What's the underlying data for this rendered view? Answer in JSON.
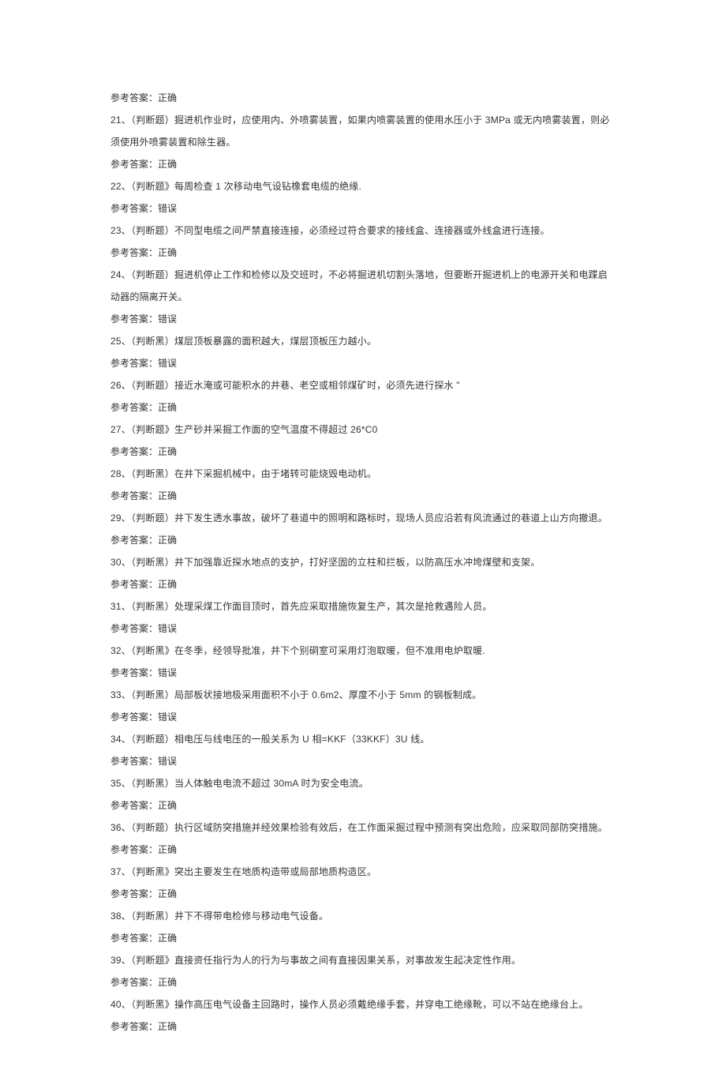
{
  "items": [
    {
      "n": "",
      "prefix": "",
      "text": "参考答案：正确",
      "type": "answer-only"
    },
    {
      "n": "21",
      "text": "、（判断题）掘进机作业时，应使用内、外喷雾装置，如果内喷雾装置的使用水压小于 3MPa 或无内喷雾装置，则必须使用外喷雾装置和除生器。",
      "answer": "参考答案：正确"
    },
    {
      "n": "22",
      "text": "、（判断题》每周检查 1 次移动电气设钻橡套电缆的绝缘.",
      "answer": "参考答案：错误"
    },
    {
      "n": "23",
      "text": "、（判断题）不同型电缆之间严禁直接连接，必须经过符合要求的接线盒、连接器或外线盒进行连接。",
      "answer": "参考答案：正确"
    },
    {
      "n": "24",
      "text": "、（判断题）掘进机停止工作和检修以及交班时，不必将掘进机切割头落地，但要断开掘进机上的电源开关和电蹀启动器的隔离开关。",
      "answer": "参考答案：错误"
    },
    {
      "n": "25",
      "text": "、（判断黑）煤层顶板暴露的面积越大，煤层顶板压力越小。",
      "answer": "参考答案：错误"
    },
    {
      "n": "26",
      "text": "、（判断题）接近水淹或可能积水的井巷、老空或相邻煤矿时，必须先进行探水 \"",
      "answer": "参考答案：正确"
    },
    {
      "n": "27",
      "text": "、（判断题》生产砂并采掘工作面的空气温度不得超过 26*C0",
      "answer": "参考答案：正确"
    },
    {
      "n": "28",
      "text": "、（判断黑）在井下采掘机械中，由于堵转可能烧毁电动机。",
      "answer": "参考答案：正确"
    },
    {
      "n": "29",
      "text": "、（判断题）井下发生透水事故，破坏了巷道中的照明和路标时，现场人员应沿若有风流通过的巷道上山方向撤退。",
      "answer": "参考答案：正确"
    },
    {
      "n": "30",
      "text": "、（判断黑）井下加强靠近探水地点的支护，打好坚固的立柱和拦板，以防高压水冲垮煤壁和支架。",
      "answer": "参考答案：正确"
    },
    {
      "n": "31",
      "text": "、（判断黑）处理采煤工作面目顶时，首先应采取措施恢复生产，其次是抢救遇险人员。",
      "answer": "参考答案：错误"
    },
    {
      "n": "32",
      "text": "、（判断黑》在冬季，经领导批准，井下个别硐室可采用灯泡取暖，但不准用电炉取暖.",
      "answer": "参考答案：错误"
    },
    {
      "n": "33",
      "text": "、（判断黑）局部板状接地极采用面积不小于 0.6m2、厚度不小于 5mm 的钢板制成。",
      "answer": "参考答案：错误"
    },
    {
      "n": "34",
      "text": "、（判断题）相电压与线电压的一般关系为 U 相=KKF（33KKF）3U 线。",
      "answer": "参考答案：错误"
    },
    {
      "n": "35",
      "text": "、（判断黑）当人体触电电流不超过 30mA 时为安全电流。",
      "answer": "参考答案：正确"
    },
    {
      "n": "36",
      "text": "、（判断题）执行区域防突措施并经效果检验有效后，在工作面采掘过程中预测有突出危险，应采取同部防突措施。",
      "answer": "参考答案：正确"
    },
    {
      "n": "37",
      "text": "、（判断黑》突出主要发生在地质构造带或局部地质构造区。",
      "answer": "参考答案：正确"
    },
    {
      "n": "38",
      "text": "、（判断黑）井下不得带电检修与移动电气设备。",
      "answer": "参考答案：正确"
    },
    {
      "n": "39",
      "text": "、（判断题》直接资任指行为人的行为与事故之间有直接因果关系，对事故发生起决定性作用。",
      "answer": "参考答案：正确"
    },
    {
      "n": "40",
      "text": "、（判断黑》操作高压电气设备主回路时，操作人员必须戴绝缘手套，并穿电工绝缘靴，可以不站在绝缘台上。",
      "answer": "参考答案：正确"
    }
  ]
}
